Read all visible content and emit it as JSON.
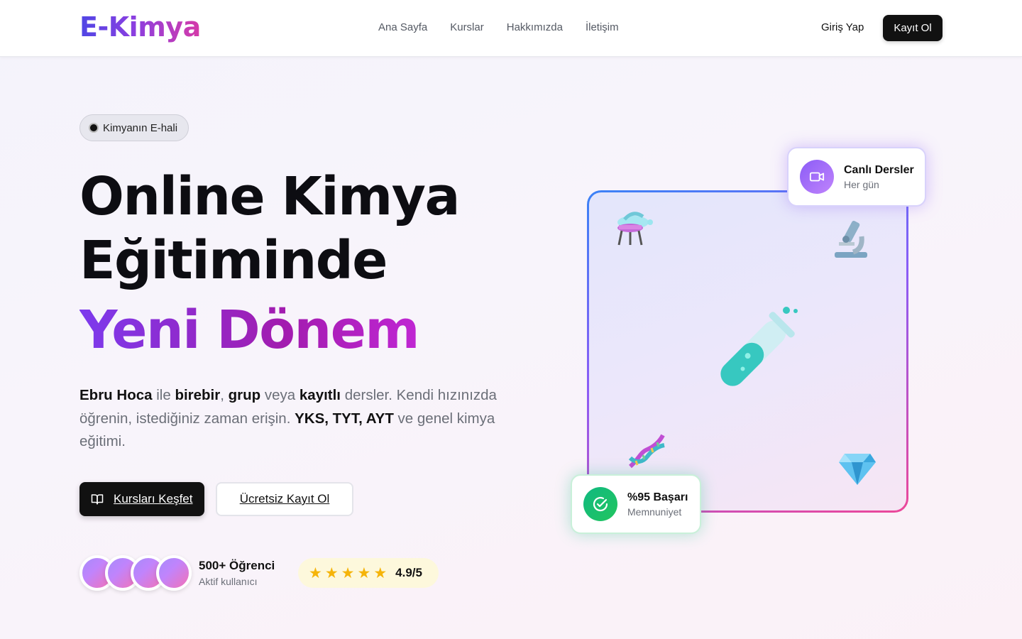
{
  "header": {
    "logo": "E-Kimya",
    "nav": [
      "Ana Sayfa",
      "Kurslar",
      "Hakkımızda",
      "İletişim"
    ],
    "login_label": "Giriş Yap",
    "signup_label": "Kayıt Ol"
  },
  "hero": {
    "badge": "Kimyanın E-hali",
    "title_line1": "Online Kimya",
    "title_line2": "Eğitiminde",
    "title_highlight": "Yeni Dönem",
    "description": {
      "p1": "Ebru Hoca",
      "p2": " ile ",
      "p3": "birebir",
      "p4": ", ",
      "p5": "grup",
      "p6": " veya ",
      "p7": "kayıtlı",
      "p8": " dersler. Kendi hızınızda öğrenin, istediğiniz zaman erişin. ",
      "p9": "YKS, TYT, AYT",
      "p10": " ve genel kimya eğitimi."
    },
    "primary_button": "Kursları Keşfet",
    "secondary_button": "Ücretsiz Kayıt Ol",
    "students_count": "500+ Öğrenci",
    "students_sub": "Aktif kullanıcı",
    "rating": {
      "stars": 5,
      "value": "4.9/5",
      "star_color": "#f5b40a"
    }
  },
  "visual": {
    "icons": [
      "flask-icon",
      "microscope-icon",
      "test-tube-icon",
      "dna-icon",
      "gem-icon"
    ],
    "live_card": {
      "title": "Canlı Dersler",
      "subtitle": "Her gün",
      "icon": "video-camera-icon"
    },
    "success_card": {
      "title": "%95 Başarı",
      "subtitle": "Memnuniyet",
      "icon": "check-circle-icon"
    }
  },
  "colors": {
    "brand_gradient": [
      "#4f46e5",
      "#8b3fe0",
      "#d63aa8"
    ],
    "highlight_gradient": [
      "#7c3aed",
      "#c026d3"
    ],
    "dark": "#111111",
    "success": "#10b981"
  }
}
